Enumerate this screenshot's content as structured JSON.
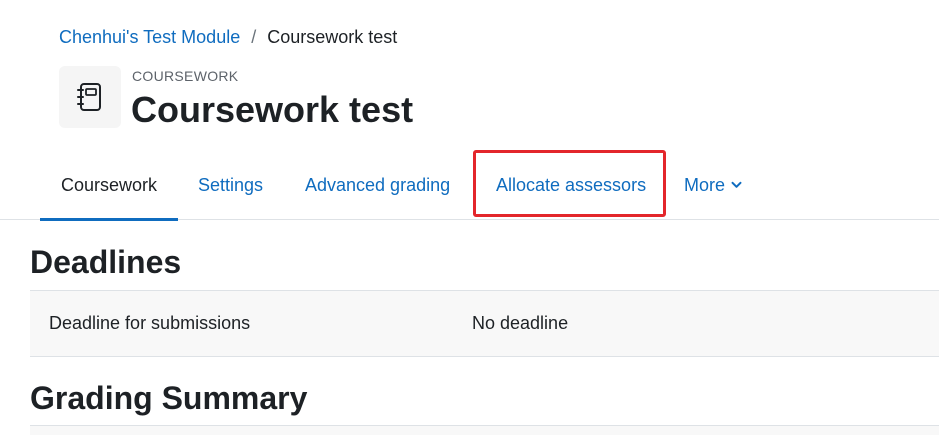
{
  "breadcrumb": {
    "course": "Chenhui's Test Module",
    "separator": "/",
    "current": "Coursework test"
  },
  "header": {
    "module_type": "COURSEWORK",
    "title": "Coursework test",
    "icon": "notebook-icon"
  },
  "tabs": [
    {
      "label": "Coursework",
      "active": true
    },
    {
      "label": "Settings",
      "active": false
    },
    {
      "label": "Advanced grading",
      "active": false
    },
    {
      "label": "Allocate assessors",
      "active": false,
      "highlighted": true
    },
    {
      "label": "More",
      "active": false,
      "icon": "chevron-down-icon"
    }
  ],
  "deadlines": {
    "heading": "Deadlines",
    "rows": [
      {
        "label": "Deadline for submissions",
        "value": "No deadline"
      }
    ]
  },
  "grading_summary": {
    "heading": "Grading Summary"
  },
  "colors": {
    "link": "#0f6cbf",
    "text": "#1d2125",
    "highlight": "#e3262b",
    "table_bg": "#f8f8f8"
  }
}
